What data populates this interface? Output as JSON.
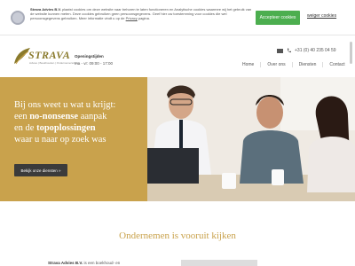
{
  "cookie": {
    "company": "Strava Advies B.V.",
    "text": " plaatst cookies om deze website naar behoren te laten functioneren en Analytische cookies waarmee wij het gebruik van de website kunnen meten. Deze cookies gebruiken geen persoonsgegevens. Geef hier uw toestemming voor cookies die wel persoonsgegevens gebruiken. Meer informatie vindt u op de ",
    "privacy_link": "Privacy",
    "text_end": " pagina.",
    "accept_label": "Accepteer cookies",
    "reject_label": "weiger cookies"
  },
  "header": {
    "logo_text": "STRAVA",
    "logo_tagline": "Advies | Boekhouden | Ondernemerschap",
    "hours_title": "Openingstijden",
    "hours_value": "ma - vr: 09:00 - 17:00",
    "phone": "+31 (0) 40 235 04 59",
    "nav": [
      "Home",
      "Over ons",
      "Diensten",
      "Contact"
    ]
  },
  "hero": {
    "line1": "Bij ons weet u wat u krijgt:",
    "line2_pre": "een ",
    "line2_bold": "no-nonsense",
    "line2_post": " aanpak",
    "line3_pre": "en de ",
    "line3_bold": "topoplossingen",
    "line4": "waar u naar op zoek was",
    "button_label": "Bekijk onze diensten »"
  },
  "section": {
    "title": "Ondernemen is vooruit kijken",
    "intro_bold": "Strava Advies B.V.",
    "intro_rest": " is een boekhoud- en"
  },
  "colors": {
    "gold": "#c9a24c",
    "accept_green": "#4cae4f",
    "dark_button": "#3b3b3b"
  }
}
